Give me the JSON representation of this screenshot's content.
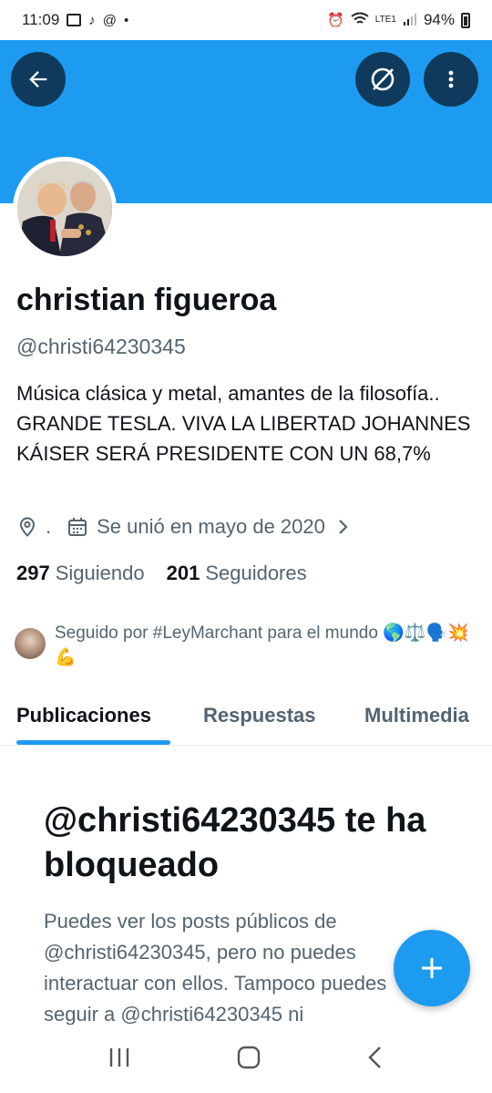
{
  "status_bar": {
    "time": "11:09",
    "battery": "94%",
    "network": "LTE1"
  },
  "header": {
    "back_icon": "arrow-left-icon",
    "grok_icon": "grok-icon",
    "more_icon": "more-vertical-icon",
    "banner_color": "#1d9bf0"
  },
  "profile": {
    "name": "christian figueroa",
    "handle": "@christi64230345",
    "bio": "Música clásica y metal, amantes de la filosofía..  GRANDE TESLA.  VIVA LA LIBERTAD  JOHANNES KÁISER SERÁ PRESIDENTE CON UN 68,7%",
    "location": ".",
    "joined": "Se unió en mayo de 2020",
    "following_count": "297",
    "following_label": "Siguiendo",
    "followers_count": "201",
    "followers_label": "Seguidores",
    "followed_by": "Seguido por #LeyMarchant para el mundo 🌎⚖️🗣️💥💪"
  },
  "tabs": [
    {
      "label": "Publicaciones",
      "active": true
    },
    {
      "label": "Respuestas",
      "active": false
    },
    {
      "label": "Multimedia",
      "active": false
    }
  ],
  "blocked": {
    "title": "@christi64230345 te ha bloqueado",
    "text": "Puedes ver los posts públicos de @christi64230345, pero no puedes interactuar con ellos. Tampoco puedes seguir a @christi64230345 ni"
  },
  "fab_icon": "plus-icon",
  "accent_color": "#1d9bf0"
}
